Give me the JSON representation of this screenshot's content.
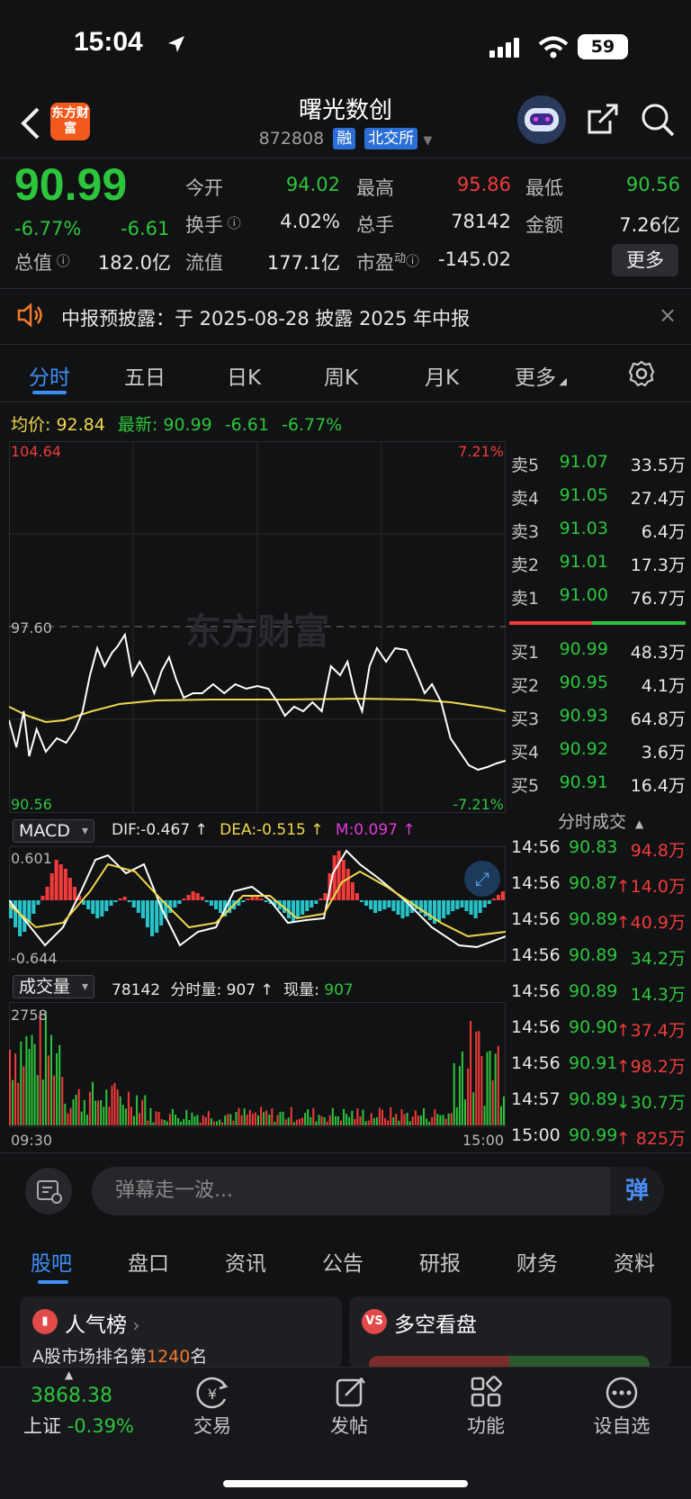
{
  "status": {
    "time": "15:04",
    "battery": "59"
  },
  "header": {
    "logo": "东方财富",
    "title": "曙光数创",
    "code": "872808",
    "tag_margin": "融",
    "tag_exchange": "北交所"
  },
  "quote": {
    "price": "90.99",
    "change_pct": "-6.77%",
    "change": "-6.61",
    "open_label": "今开",
    "open": "94.02",
    "high_label": "最高",
    "high": "95.86",
    "low_label": "最低",
    "low": "90.56",
    "turnover_label": "换手",
    "turnover": "4.02%",
    "volume_label": "总手",
    "volume": "78142",
    "amount_label": "金额",
    "amount": "7.26亿",
    "mktcap_label": "总值",
    "mktcap": "182.0亿",
    "float_label": "流值",
    "float": "177.1亿",
    "pe_label": "市盈",
    "pe_sup": "动",
    "pe": "-145.02",
    "more_label": "更多"
  },
  "notice": {
    "text": "中报预披露：于 2025-08-28 披露 2025 年中报"
  },
  "chart_tabs": [
    "分时",
    "五日",
    "日K",
    "周K",
    "月K",
    "更多"
  ],
  "summary": {
    "avg_label": "均价:",
    "avg": "92.84",
    "latest_label": "最新:",
    "latest": "90.99",
    "change": "-6.61",
    "change_pct": "-6.77%"
  },
  "chart_data": {
    "type": "line",
    "price_axis": {
      "top": "104.64",
      "mid": "97.60",
      "bottom": "90.56",
      "top_pct": "7.21%",
      "bottom_pct": "-7.21%"
    },
    "time_axis": {
      "start": "09:30",
      "end": "15:00"
    },
    "watermark": "东方财富"
  },
  "macd": {
    "label": "MACD",
    "dif": "DIF:-0.467 ↑",
    "dea": "DEA:-0.515 ↑",
    "m": "M:0.097 ↑",
    "ymax": "0.601",
    "ymin": "-0.644"
  },
  "volume": {
    "label": "成交量",
    "total": "78142",
    "minute": "分时量: 907 ↑",
    "now_label": "现量:",
    "now": "907",
    "ymax": "2758"
  },
  "orderbook": {
    "asks": [
      {
        "label": "卖5",
        "price": "91.07",
        "vol": "33.5万"
      },
      {
        "label": "卖4",
        "price": "91.05",
        "vol": "27.4万"
      },
      {
        "label": "卖3",
        "price": "91.03",
        "vol": "6.4万"
      },
      {
        "label": "卖2",
        "price": "91.01",
        "vol": "17.3万"
      },
      {
        "label": "卖1",
        "price": "91.00",
        "vol": "76.7万"
      }
    ],
    "bids": [
      {
        "label": "买1",
        "price": "90.99",
        "vol": "48.3万"
      },
      {
        "label": "买2",
        "price": "90.95",
        "vol": "4.1万"
      },
      {
        "label": "买3",
        "price": "90.93",
        "vol": "64.8万"
      },
      {
        "label": "买4",
        "price": "90.92",
        "vol": "3.6万"
      },
      {
        "label": "买5",
        "price": "90.91",
        "vol": "16.4万"
      }
    ]
  },
  "ticks": {
    "header": "分时成交",
    "rows": [
      {
        "time": "14:56",
        "price": "90.83",
        "vol": "94.8万",
        "c": "r"
      },
      {
        "time": "14:56",
        "price": "90.87",
        "vol": "↑14.0万",
        "c": "r"
      },
      {
        "time": "14:56",
        "price": "90.89",
        "vol": "↑40.9万",
        "c": "r"
      },
      {
        "time": "14:56",
        "price": "90.89",
        "vol": "34.2万",
        "c": "g"
      },
      {
        "time": "14:56",
        "price": "90.89",
        "vol": "14.3万",
        "c": "g"
      },
      {
        "time": "14:56",
        "price": "90.90",
        "vol": "↑37.4万",
        "c": "r"
      },
      {
        "time": "14:56",
        "price": "90.91",
        "vol": "↑98.2万",
        "c": "r"
      },
      {
        "time": "14:57",
        "price": "90.89",
        "vol": "↓30.7万",
        "c": "g"
      },
      {
        "time": "15:00",
        "price": "90.99",
        "vol": "↑ 825万",
        "c": "r"
      }
    ]
  },
  "danmaku": {
    "placeholder": "弹幕走一波...",
    "send": "弹"
  },
  "bottom_tabs": [
    "股吧",
    "盘口",
    "资讯",
    "公告",
    "研报",
    "财务",
    "资料"
  ],
  "cards": {
    "popular_title": "人气榜",
    "popular_desc_pre": "A股市场排名第",
    "popular_rank": "1240",
    "popular_desc_post": "名",
    "longshort_title": "多空看盘"
  },
  "bottom_bar": {
    "index_value": "3868.38",
    "index_name": "上证",
    "index_change": "-0.39%",
    "items": [
      "交易",
      "发帖",
      "功能",
      "设自选"
    ]
  },
  "colors": {
    "up": "#f23b3b",
    "down": "#2dc53c",
    "avg": "#f1d84b",
    "accent": "#3d8ff5"
  }
}
